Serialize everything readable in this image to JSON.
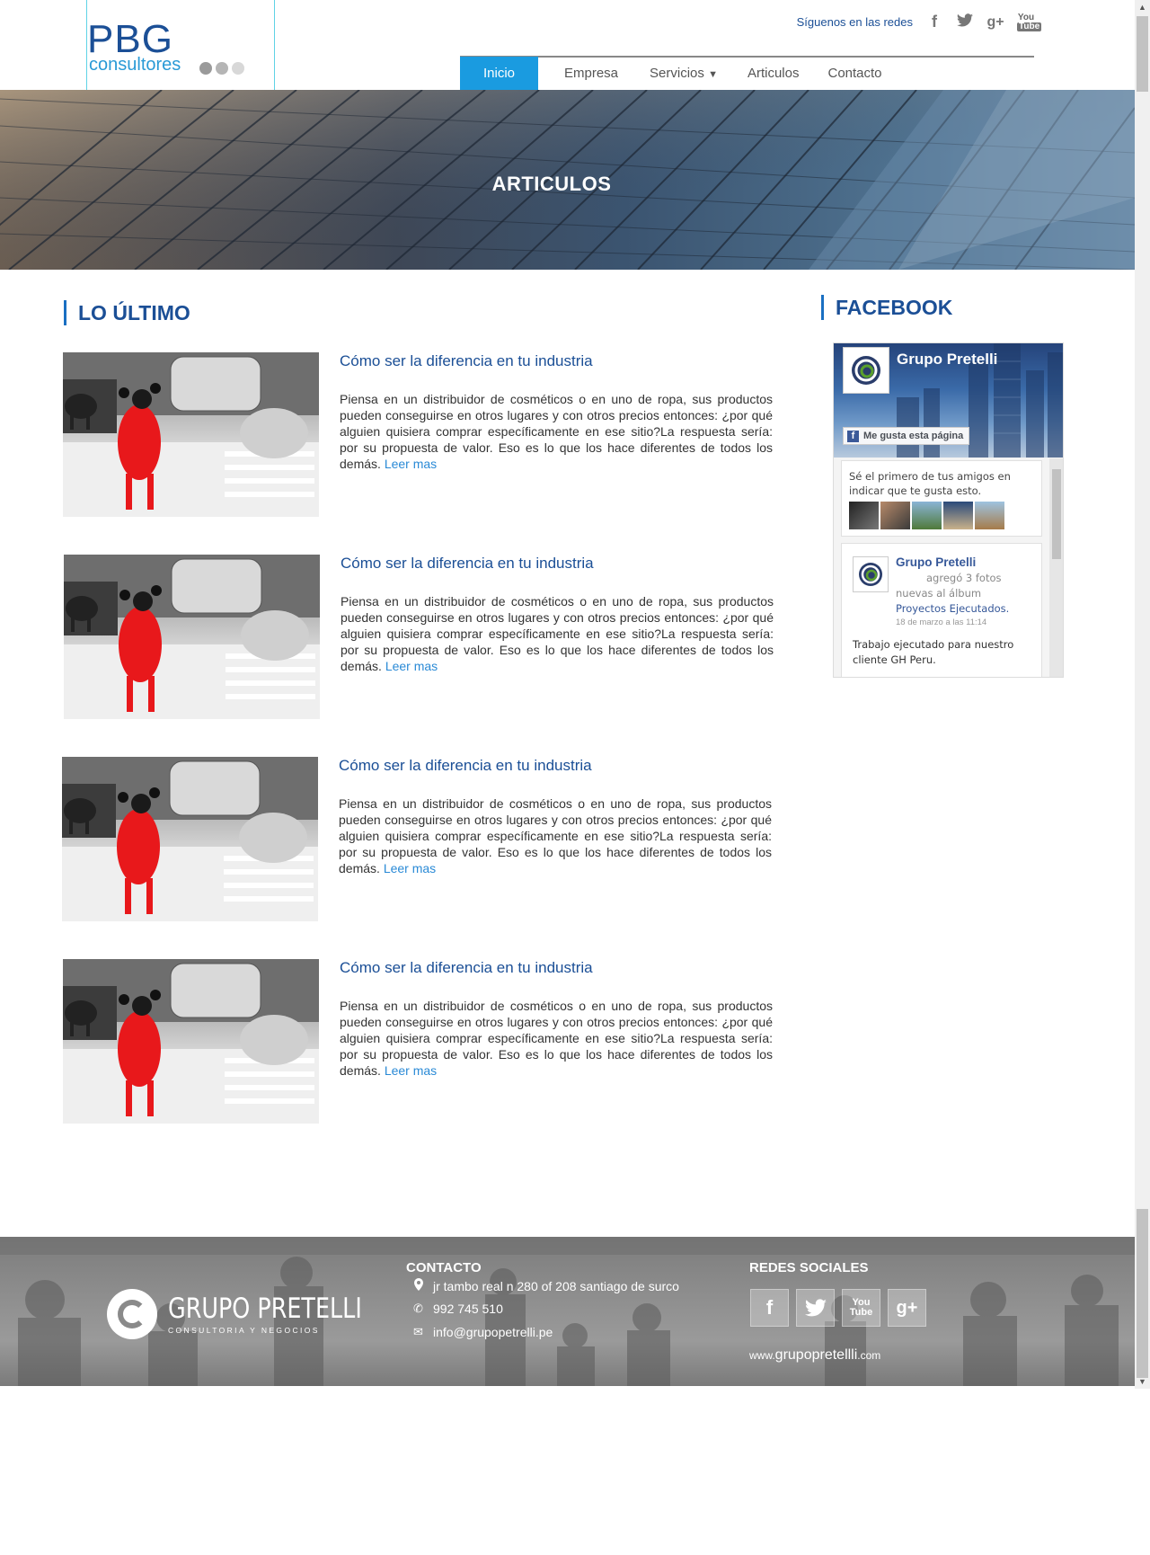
{
  "header": {
    "logo": {
      "main": "PBG",
      "sub": "consultores",
      "dot_colors": [
        "#9a9a9a",
        "#b5b5b5",
        "#d8d8d8"
      ]
    },
    "social": {
      "label": "Síguenos en las redes",
      "icons": [
        "facebook-icon",
        "twitter-icon",
        "google-plus-icon",
        "youtube-icon"
      ]
    },
    "nav": {
      "items": [
        "Inicio",
        "Empresa",
        "Servicios",
        "Articulos",
        "Contacto"
      ],
      "active": "Inicio",
      "accent": "#1a9be0"
    }
  },
  "hero": {
    "title": "ARTICULOS"
  },
  "main": {
    "section_title": "LO ÚLTIMO",
    "articles": [
      {
        "title": "Cómo ser la diferencia en tu industria",
        "text": "Piensa en un distribuidor de cosméticos o en uno de ropa, sus productos pueden conseguirse en otros lugares y con otros precios entonces: ¿por qué alguien quisiera comprar específicamente en ese sitio?La respuesta sería: por su propuesta de valor. Eso es lo que los hace diferentes de todos los demás.",
        "link": "Leer mas"
      },
      {
        "title": "Cómo ser la diferencia en tu industria",
        "text": "Piensa en un distribuidor de cosméticos o en uno de ropa, sus productos pueden conseguirse en otros lugares y con otros precios entonces: ¿por qué alguien quisiera comprar específicamente en ese sitio?La respuesta sería: por su propuesta de valor. Eso es lo que los hace diferentes de todos los demás.",
        "link": "Leer mas"
      },
      {
        "title": "Cómo ser la diferencia en tu industria",
        "text": "Piensa en un distribuidor de cosméticos o en uno de ropa, sus productos pueden conseguirse en otros lugares y con otros precios entonces: ¿por qué alguien quisiera comprar específicamente en ese sitio?La respuesta sería: por su propuesta de valor. Eso es lo que los hace diferentes de todos los demás.",
        "link": "Leer mas"
      },
      {
        "title": "Cómo ser la diferencia en tu industria",
        "text": "Piensa en un distribuidor de cosméticos o en uno de ropa, sus productos pueden conseguirse en otros lugares y con otros precios entonces: ¿por qué alguien quisiera comprar específicamente en ese sitio?La respuesta sería: por su propuesta de valor. Eso es lo que los hace diferentes de todos los demás.",
        "link": "Leer mas"
      }
    ]
  },
  "sidebar": {
    "title": "FACEBOOK",
    "widget": {
      "page_name": "Grupo Pretelli",
      "like_button": "Me gusta esta página",
      "friends_text": "Sé el primero de tus amigos en indicar que te gusta esto.",
      "post": {
        "author": "Grupo Pretelli",
        "action": "agregó 3 fotos nuevas al álbum",
        "album": "Proyectos Ejecutados.",
        "date": "18 de marzo a las 11:14",
        "text": "Trabajo ejecutado para nuestro cliente GH Peru."
      }
    }
  },
  "footer": {
    "brand": {
      "name": "GRUPO PRETELLI",
      "tagline": "CONSULTORIA Y NEGOCIOS"
    },
    "contact": {
      "title": "CONTACTO",
      "address": "jr tambo real n 280 of 208 santiago de surco",
      "phone": "992 745 510",
      "email": "info@grupopetrelli.pe"
    },
    "social": {
      "title": "REDES SOCIALES",
      "icons": [
        "facebook-icon",
        "twitter-icon",
        "youtube-icon",
        "google-plus-icon"
      ],
      "url_prefix": "www.",
      "url_main": "grupopretellli",
      "url_suffix": ".com"
    }
  }
}
